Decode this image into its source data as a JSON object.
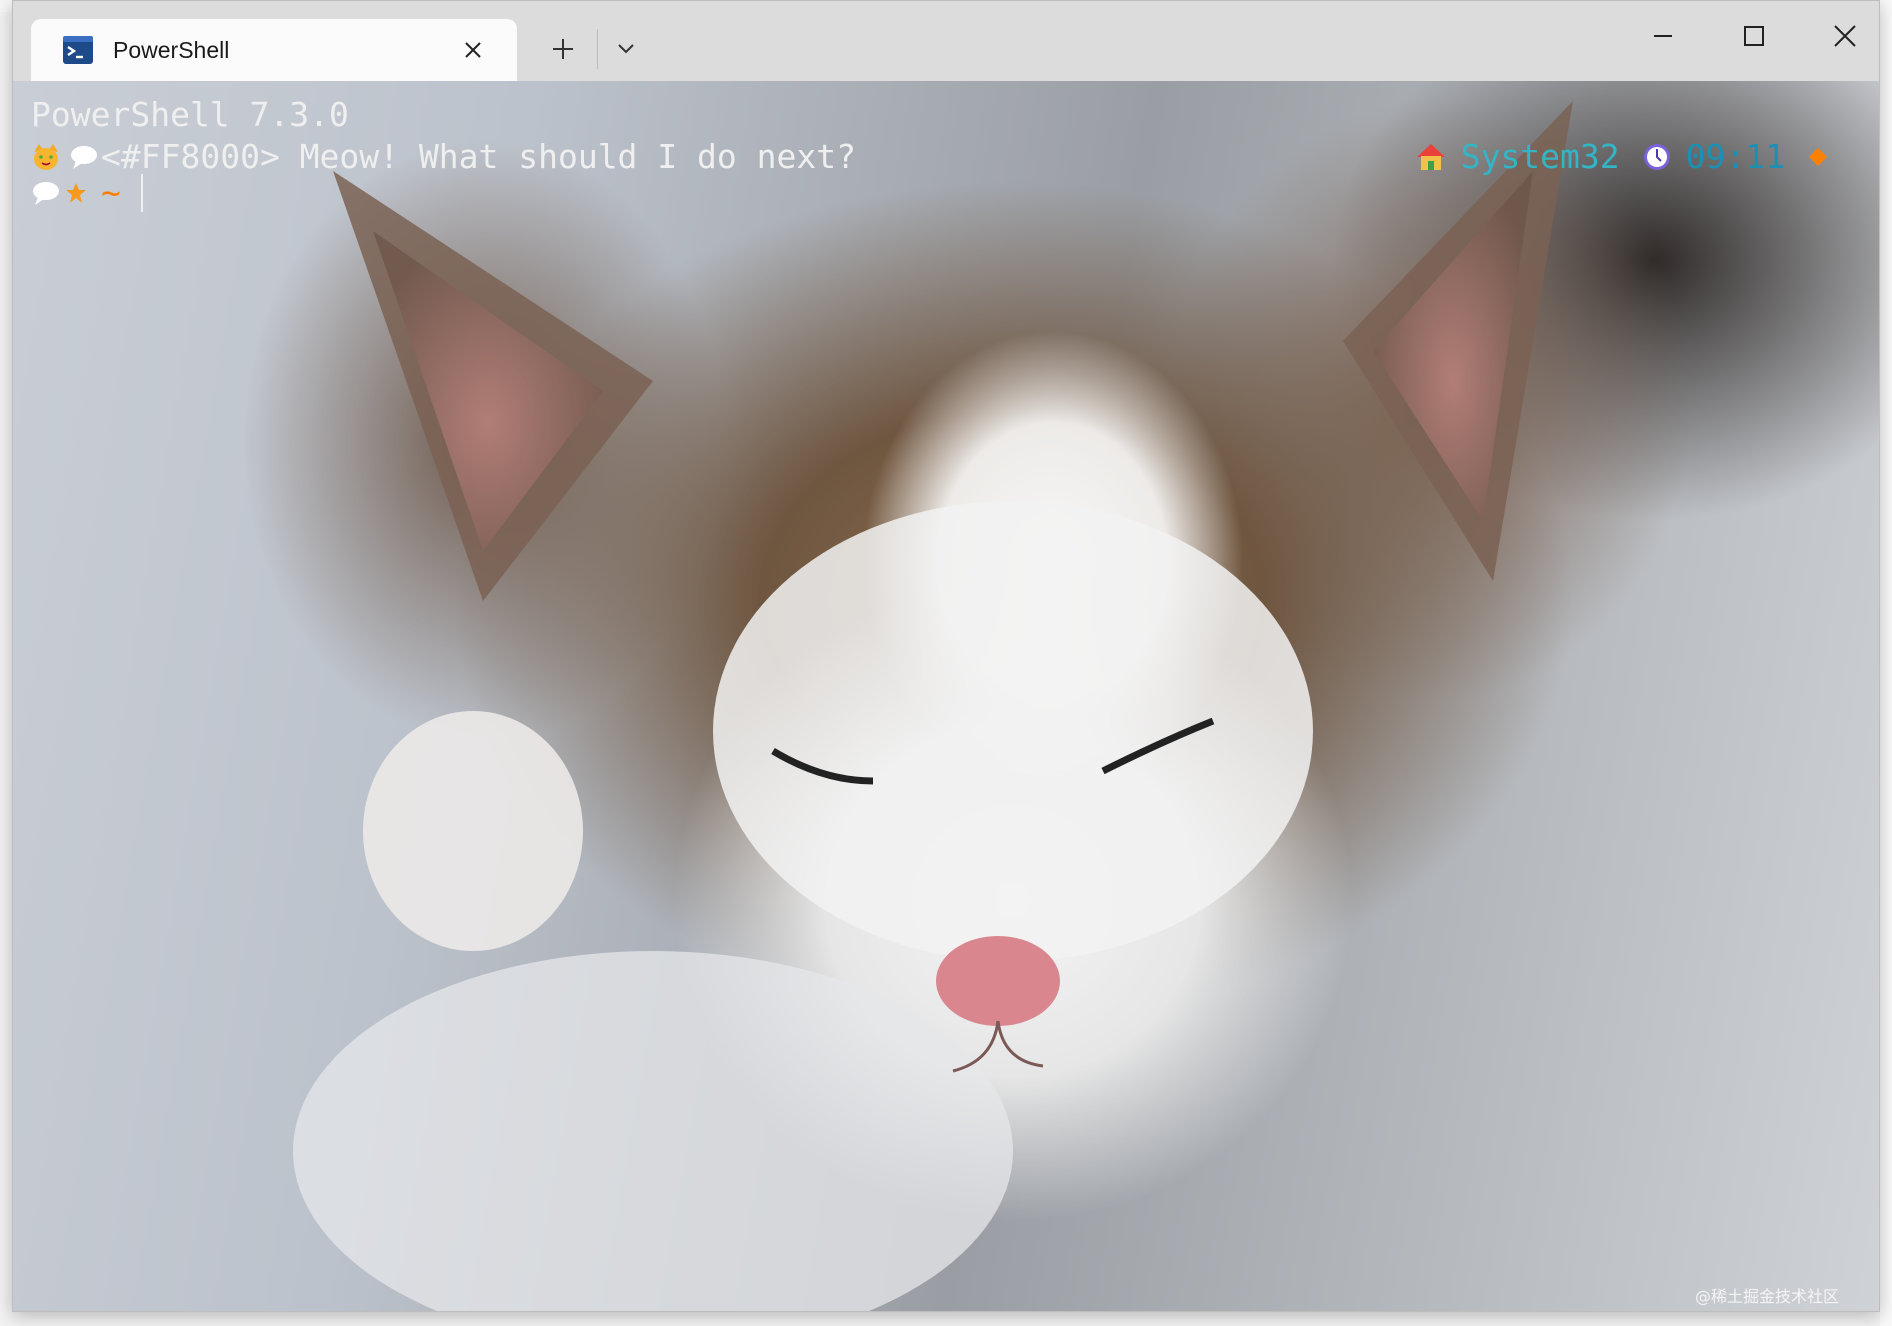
{
  "window": {
    "tab_title": "PowerShell",
    "controls": {
      "minimize": "minimize-icon",
      "maximize": "maximize-icon",
      "close": "close-icon"
    }
  },
  "terminal": {
    "banner": "PowerShell 7.3.0",
    "prompt_message": "<#FF8000> Meow! What should I do next?",
    "prompt_symbol": "~",
    "right_prompt": {
      "folder": "System32",
      "time": "09:11"
    }
  },
  "colors": {
    "folder_text": "#33b5c5",
    "time_text": "#1c8fb5",
    "prompt_accent": "#ff8000"
  },
  "watermark": "@稀土掘金技术社区"
}
